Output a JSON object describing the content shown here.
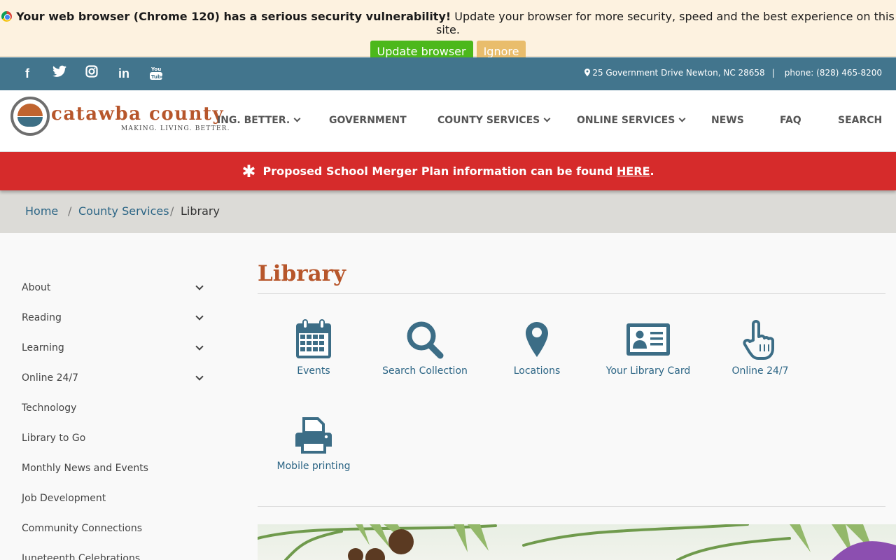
{
  "update_banner": {
    "warning_bold": "Your web browser (Chrome 120) has a serious security vulnerability!",
    "warning_rest": "Update your browser for more security, speed and the best experience on this site.",
    "update_button": "Update browser",
    "ignore_button": "Ignore"
  },
  "topbar": {
    "social": [
      "f",
      "twitter",
      "instagram",
      "in",
      "You Tube"
    ],
    "address": "25 Government Drive Newton, NC 28658",
    "separator": "|",
    "phone": "phone: (828) 465-8200"
  },
  "header": {
    "logo_name": "catawba county",
    "logo_tagline": "MAKING. LIVING. BETTER.",
    "nav": [
      "ING. BETTER.",
      "GOVERNMENT",
      "COUNTY SERVICES",
      "ONLINE SERVICES",
      "NEWS",
      "FAQ",
      "SEARCH"
    ]
  },
  "alert": {
    "icon": "asterisk-icon",
    "text": "Proposed School Merger Plan information can be found",
    "link": "HERE",
    "end": "."
  },
  "breadcrumb": {
    "home": "Home",
    "sep": "/",
    "county_services": "County Services",
    "current": "Library"
  },
  "sidebar": {
    "items": [
      {
        "label": "About"
      },
      {
        "label": "Reading"
      },
      {
        "label": "Learning"
      },
      {
        "label": "Online 24/7"
      },
      {
        "label": "Technology"
      },
      {
        "label": "Library to Go"
      },
      {
        "label": "Monthly News and Events"
      },
      {
        "label": "Job Development"
      },
      {
        "label": "Community Connections"
      },
      {
        "label": "Juneteenth Celebrations"
      }
    ]
  },
  "main": {
    "title": "Library",
    "tiles": [
      {
        "label": "Events",
        "icon": "calendar-icon"
      },
      {
        "label": "Search Collection",
        "icon": "magnifier-icon"
      },
      {
        "label": "Locations",
        "icon": "map-pin-icon"
      },
      {
        "label": "Your Library Card",
        "icon": "id-card-icon"
      },
      {
        "label": "Online 24/7",
        "icon": "pointing-hand-icon"
      },
      {
        "label": "Mobile printing",
        "icon": "printer-icon"
      }
    ]
  },
  "colors": {
    "brand_orange": "#b7562b",
    "brand_blue": "#42758d",
    "link_blue": "#2c6585",
    "alert_red": "#d62b2b",
    "update_green": "#4cb81b",
    "ignore_gold": "#e9bd6c",
    "icon_blue": "#3c6d86"
  }
}
